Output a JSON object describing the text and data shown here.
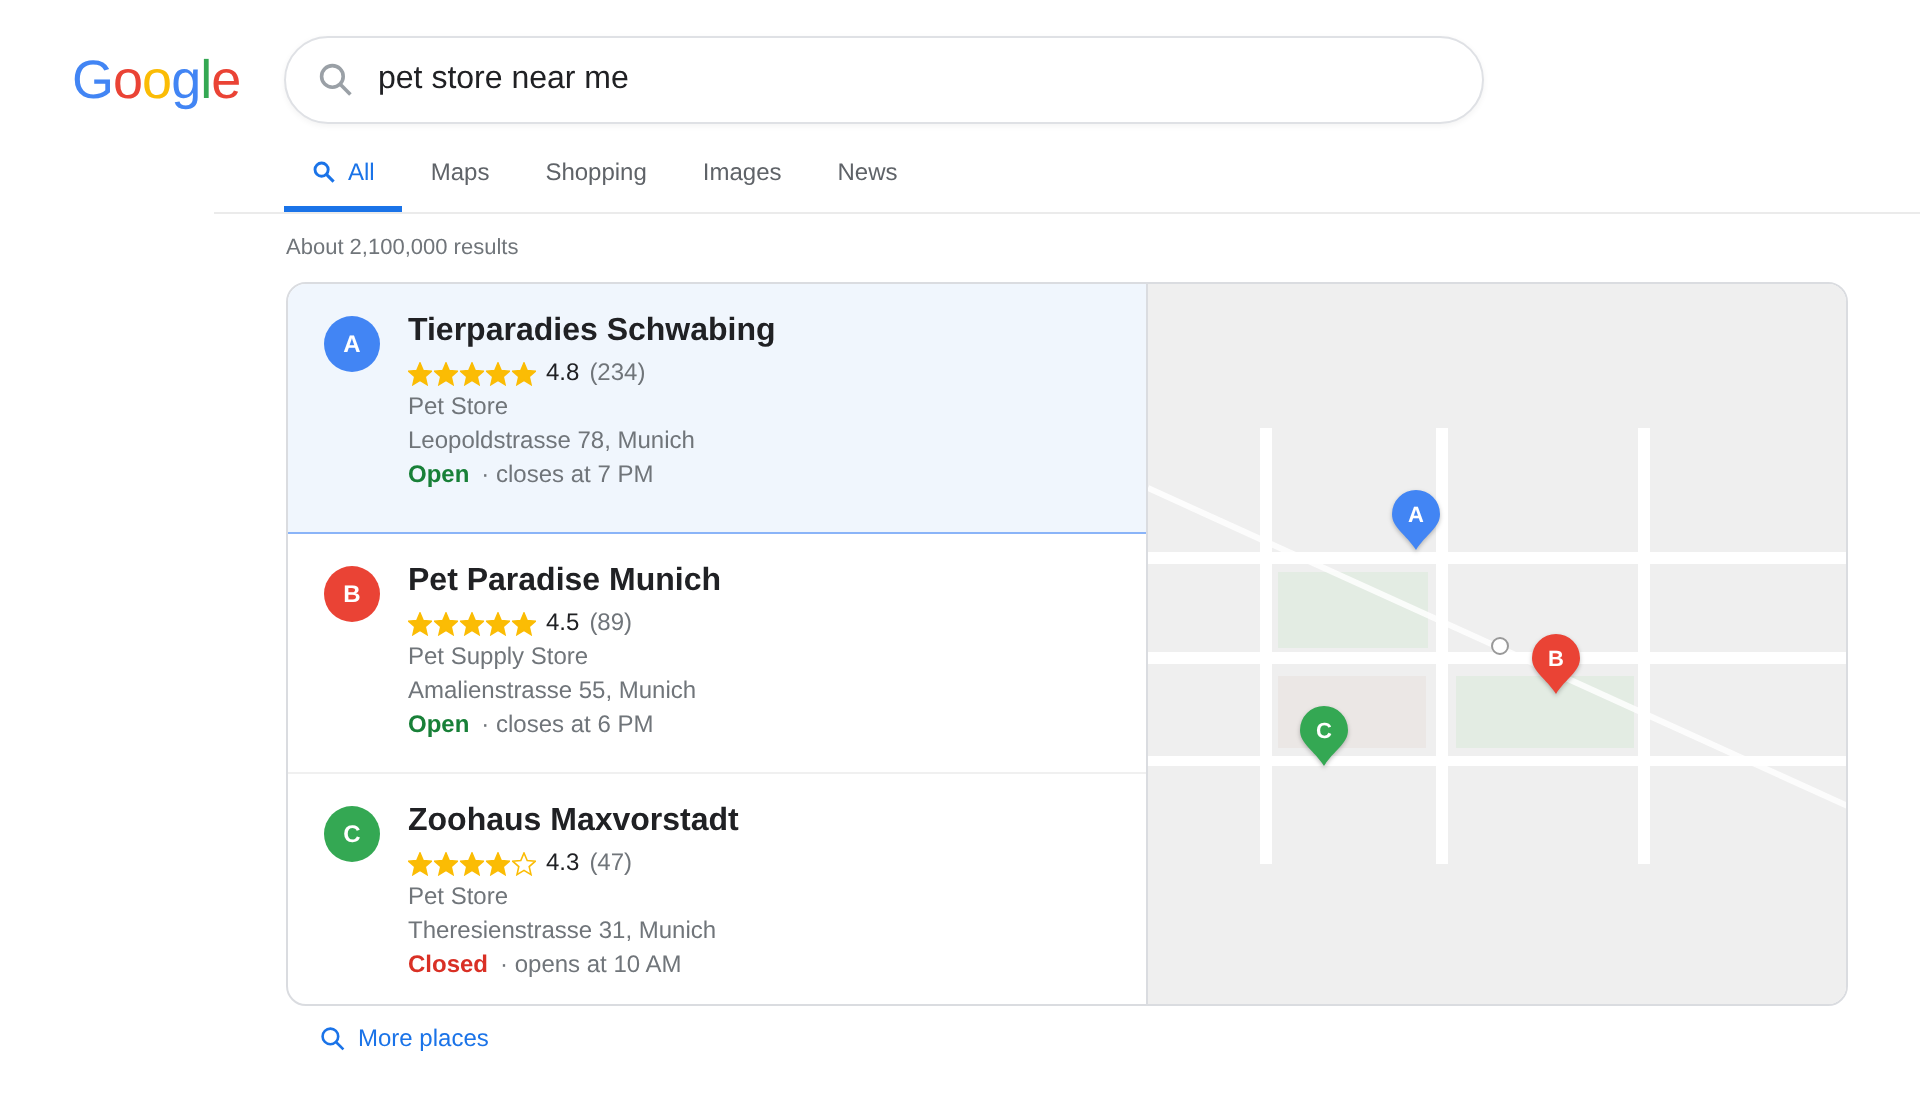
{
  "logo": "Google",
  "search": {
    "value": "pet store near me"
  },
  "tabs": [
    {
      "label": "All",
      "selected": true,
      "icon": true
    },
    {
      "label": "Maps",
      "selected": false
    },
    {
      "label": "Shopping",
      "selected": false
    },
    {
      "label": "Images",
      "selected": false
    },
    {
      "label": "News",
      "selected": false
    }
  ],
  "result_count": "About 2,100,000 results",
  "places": [
    {
      "letter": "A",
      "color": "#4285f4",
      "name": "Tierparadies Schwabing",
      "stars": 5,
      "rating": "4.8",
      "reviews": "(234)",
      "category": "Pet Store",
      "address": "Leopoldstrasse 78, Munich",
      "open": true,
      "status": "Open",
      "hours": "· closes at 7 PM",
      "selected": true
    },
    {
      "letter": "B",
      "color": "#ea4335",
      "name": "Pet Paradise Munich",
      "stars": 5,
      "rating": "4.5",
      "reviews": "(89)",
      "category": "Pet Supply Store",
      "address": "Amalienstrasse 55, Munich",
      "open": true,
      "status": "Open",
      "hours": "· closes at 6 PM",
      "selected": false
    },
    {
      "letter": "C",
      "color": "#34a853",
      "name": "Zoohaus Maxvorstadt",
      "stars": 4,
      "rating": "4.3",
      "reviews": "(47)",
      "category": "Pet Store",
      "address": "Theresienstrasse 31, Munich",
      "open": false,
      "status": "Closed",
      "hours": "· opens at 10 AM",
      "selected": false
    }
  ],
  "map": {
    "pins": [
      {
        "letter": "A",
        "color": "#4285f4"
      },
      {
        "letter": "B",
        "color": "#ea4335"
      },
      {
        "letter": "C",
        "color": "#34a853"
      }
    ]
  },
  "more_link": "More places"
}
